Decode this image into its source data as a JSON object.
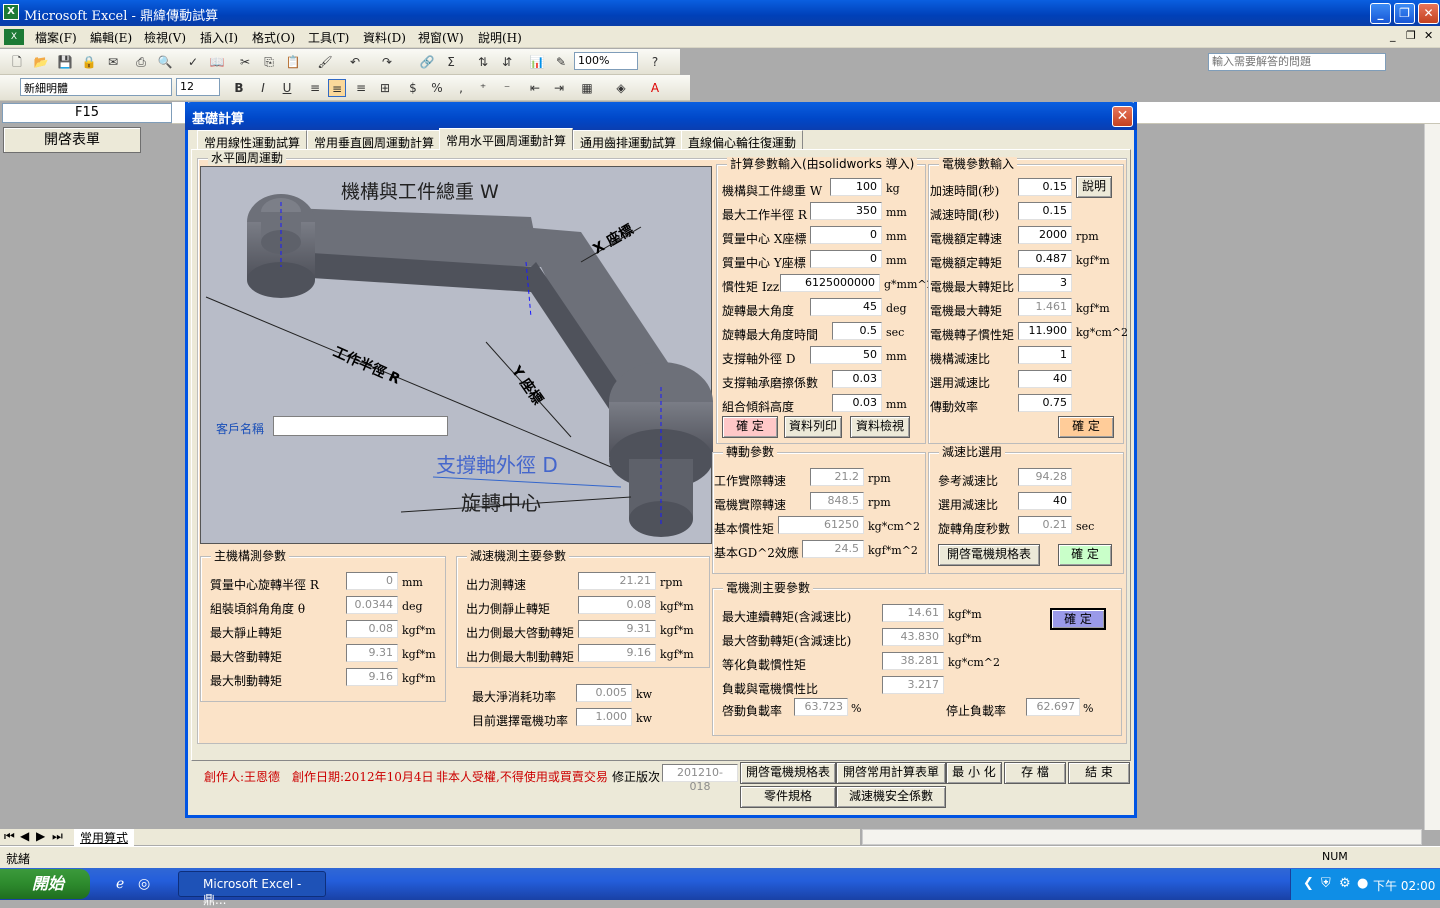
{
  "app": {
    "title": "Microsoft Excel - 鼎緯傳動試算",
    "ask_placeholder": "輸入需要解答的問題"
  },
  "menu": [
    "檔案(F)",
    "編輯(E)",
    "檢視(V)",
    "插入(I)",
    "格式(O)",
    "工具(T)",
    "資料(D)",
    "視窗(W)",
    "說明(H)"
  ],
  "toolbar": {
    "zoom": "100%",
    "font": "新細明體",
    "size": "12"
  },
  "namebox": "F15",
  "sheet": {
    "open_form": "開啓表單",
    "tab": "常用算式"
  },
  "status": {
    "ready": "就緒",
    "num": "NUM"
  },
  "taskbar": {
    "start": "開始",
    "task": "Microsoft Excel - 鼎...",
    "clock": "下午 02:00"
  },
  "dialog": {
    "title": "基礎計算",
    "tabs": [
      "常用線性運動試算",
      "常用垂直圓周運動計算",
      "常用水平圓周運動計算",
      "通用齒排運動試算",
      "直線偏心輪往復運動"
    ],
    "panel_title": "水平圓周運動",
    "drawing": {
      "weight": "機構與工件總重 W",
      "x_axis": "X 座標",
      "y_axis": "Y 座標",
      "radius": "工作半徑 R",
      "shaft": "支撐軸外徑 D",
      "center": "旋轉中心",
      "customer_label": "客戶名稱",
      "customer_value": ""
    },
    "calc": {
      "title": "計算參數輸入(由solidworks 導入)",
      "rows": [
        {
          "label": "機構與工件總重 W",
          "value": "100",
          "unit": "kg"
        },
        {
          "label": "最大工作半徑 R",
          "value": "350",
          "unit": "mm"
        },
        {
          "label": "質量中心 X座標",
          "value": "0",
          "unit": "mm"
        },
        {
          "label": "質量中心 Y座標",
          "value": "0",
          "unit": "mm"
        },
        {
          "label": "慣性矩 Izz",
          "value": "6125000000",
          "unit": "g*mm^2"
        },
        {
          "label": "旋轉最大角度",
          "value": "45",
          "unit": "deg"
        },
        {
          "label": "旋轉最大角度時間",
          "value": "0.5",
          "unit": "sec"
        },
        {
          "label": "支撐軸外徑 D",
          "value": "50",
          "unit": "mm"
        },
        {
          "label": "支撐軸承磨擦係數",
          "value": "0.03",
          "unit": ""
        },
        {
          "label": "組合傾斜高度",
          "value": "0.03",
          "unit": "mm"
        }
      ],
      "confirm": "確  定",
      "print": "資料列印",
      "check": "資料檢視"
    },
    "motor_in": {
      "title": "電機參數輸入",
      "rows": [
        {
          "label": "加速時間(秒)",
          "value": "0.15",
          "unit": ""
        },
        {
          "label": "減速時間(秒)",
          "value": "0.15",
          "unit": ""
        },
        {
          "label": "電機額定轉速",
          "value": "2000",
          "unit": "rpm"
        },
        {
          "label": "電機額定轉矩",
          "value": "0.487",
          "unit": "kgf*m"
        },
        {
          "label": "電機最大轉矩比",
          "value": "3",
          "unit": ""
        },
        {
          "label": "電機最大轉矩",
          "value": "1.461",
          "unit": "kgf*m"
        },
        {
          "label": "電機轉子慣性矩",
          "value": "11.900",
          "unit": "kg*cm^2"
        },
        {
          "label": "機構減速比",
          "value": "1",
          "unit": ""
        },
        {
          "label": "選用減速比",
          "value": "40",
          "unit": ""
        },
        {
          "label": "傳動效率",
          "value": "0.75",
          "unit": ""
        }
      ],
      "explain": "說明",
      "confirm": "確  定"
    },
    "rot": {
      "title": "轉動參數",
      "rows": [
        {
          "label": "工作實際轉速",
          "value": "21.2",
          "unit": "rpm"
        },
        {
          "label": "電機實際轉速",
          "value": "848.5",
          "unit": "rpm"
        },
        {
          "label": "基本慣性矩",
          "value": "61250",
          "unit": "kg*cm^2"
        },
        {
          "label": "基本GD^2效應",
          "value": "24.5",
          "unit": "kgf*m^2"
        }
      ]
    },
    "ratio": {
      "title": "減速比選用",
      "rows": [
        {
          "label": "參考減速比",
          "value": "94.28",
          "unit": ""
        },
        {
          "label": "選用減速比",
          "value": "40",
          "unit": ""
        },
        {
          "label": "旋轉角度秒數",
          "value": "0.21",
          "unit": "sec"
        }
      ],
      "open_spec": "開啓電機規格表",
      "confirm": "確  定"
    },
    "main": {
      "title": "主機構測參數",
      "rows": [
        {
          "label": "質量中心旋轉半徑 R",
          "value": "0",
          "unit": "mm"
        },
        {
          "label": "組裝頃斜角角度 θ",
          "value": "0.0344",
          "unit": "deg"
        },
        {
          "label": "最大靜止轉矩",
          "value": "0.08",
          "unit": "kgf*m"
        },
        {
          "label": "最大啓動轉矩",
          "value": "9.31",
          "unit": "kgf*m"
        },
        {
          "label": "最大制動轉矩",
          "value": "9.16",
          "unit": "kgf*m"
        }
      ]
    },
    "reducer": {
      "title": "減速機測主要參數",
      "rows": [
        {
          "label": "出力測轉速",
          "value": "21.21",
          "unit": "rpm"
        },
        {
          "label": "出力側靜止轉矩",
          "value": "0.08",
          "unit": "kgf*m"
        },
        {
          "label": "出力側最大啓動轉矩",
          "value": "9.31",
          "unit": "kgf*m"
        },
        {
          "label": "出力側最大制動轉矩",
          "value": "9.16",
          "unit": "kgf*m"
        }
      ],
      "power": [
        {
          "label": "最大淨消耗功率",
          "value": "0.005",
          "unit": "kw"
        },
        {
          "label": "目前選擇電機功率",
          "value": "1.000",
          "unit": "kw"
        }
      ]
    },
    "motor_side": {
      "title": "電機測主要參數",
      "rows": [
        {
          "label": "最大連續轉矩(含減速比)",
          "value": "14.61",
          "unit": "kgf*m"
        },
        {
          "label": "最大啓動轉矩(含減速比)",
          "value": "43.830",
          "unit": "kgf*m"
        },
        {
          "label": "等化負載慣性矩",
          "value": "38.281",
          "unit": "kg*cm^2"
        },
        {
          "label": "負載與電機慣性比",
          "value": "3.217",
          "unit": ""
        }
      ],
      "start_label": "啓動負載率",
      "start_value": "63.723",
      "start_unit": "%",
      "stop_label": "停止負載率",
      "stop_value": "62.697",
      "stop_unit": "%",
      "confirm": "確  定"
    },
    "footer": {
      "author": "創作人:王恩德",
      "date": "創作日期:2012年10月4日",
      "notice": "非本人受權,不得使用或買賣交易",
      "version_label": "修正版次",
      "version": "201210-018",
      "btns": [
        "開啓電機規格表",
        "開啓常用計算表單",
        "最 小 化",
        "存  檔",
        "結  束"
      ],
      "btns2": [
        "零件規格",
        "減速機安全係數"
      ]
    }
  }
}
